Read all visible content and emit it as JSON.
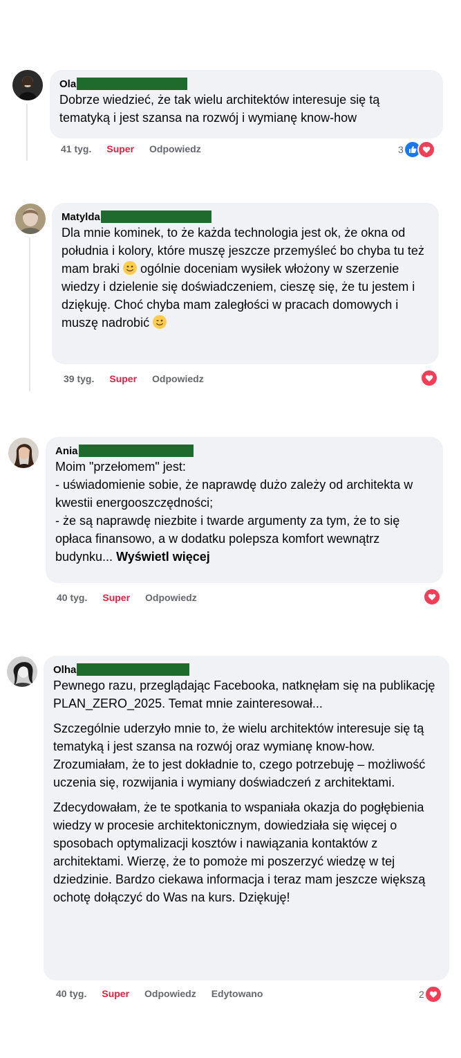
{
  "comments": [
    {
      "name": "Ola",
      "paragraphs": [
        "Dobrze wiedzieć, że tak wielu architektów interesuje się tą tematyką i jest szansa na rozwój i wymianę know-how"
      ],
      "time": "41 tyg.",
      "reaction_label": "Super",
      "reply_label": "Odpowiedz",
      "reaction_count": "3",
      "reactions": [
        "like-icon",
        "love-icon"
      ]
    },
    {
      "name": "Matylda",
      "paragraphs": [
        "Dla mnie kominek, to że każda technologia jest ok, że okna od południa i kolory, które muszę jeszcze przemyśleć bo chyba tu też mam braki",
        "ogólnie doceniam wysiłek włożony w szerzenie wiedzy i dzielenie się doświadczeniem, cieszę się, że tu jestem i dziękuję. Choć chyba mam zaległości w pracach domowych i muszę nadrobić"
      ],
      "time": "39 tyg.",
      "reaction_label": "Super",
      "reply_label": "Odpowiedz",
      "reactions": [
        "love-icon"
      ]
    },
    {
      "name": "Ania",
      "paragraphs": [
        "Moim \"przełomem\" jest:",
        "- uświadomienie sobie, że naprawdę dużo zależy od architekta w kwestii energooszczędności;",
        "- że są naprawdę niezbite i twarde argumenty za tym, że to się opłaca finansowo, a w dodatku polepsza komfort wewnątrz budynku..."
      ],
      "see_more": "Wyświetl więcej",
      "time": "40 tyg.",
      "reaction_label": "Super",
      "reply_label": "Odpowiedz",
      "reactions": [
        "love-icon"
      ]
    },
    {
      "name": "Olha",
      "paragraphs": [
        "Pewnego razu, przeglądając Facebooka, natknęłam się na publikację PLAN_ZERO_2025. Temat mnie zainteresował...",
        "Szczególnie uderzyło mnie to, że wielu architektów interesuje się tą tematyką i jest szansa na rozwój oraz wymianę know-how. Zrozumiałam, że to jest dokładnie to, czego potrzebuję – możliwość uczenia się, rozwijania i wymiany doświadczeń z architektami.",
        "Zdecydowałam, że te spotkania to wspaniała okazja do pogłębienia wiedzy w procesie architektonicznym, dowiedziała się więcej o sposobach optymalizacji kosztów i nawiązania kontaktów z architektami. Wierzę, że to pomoże mi poszerzyć wiedzę w tej dziedzinie. Bardzo ciekawa informacja i teraz mam jeszcze większą ochotę dołączyć do Was na kurs. Dziękuję!"
      ],
      "time": "40 tyg.",
      "reaction_label": "Super",
      "reply_label": "Odpowiedz",
      "edited_label": "Edytowano",
      "reaction_count": "2",
      "reactions": [
        "love-icon"
      ]
    }
  ],
  "colors": {
    "bubble": "#f0f2f5",
    "super": "#e41e3f",
    "meta": "#65676b",
    "like": "#1877f2",
    "love": "#f33e58",
    "redaction": "#1e6b2d"
  }
}
